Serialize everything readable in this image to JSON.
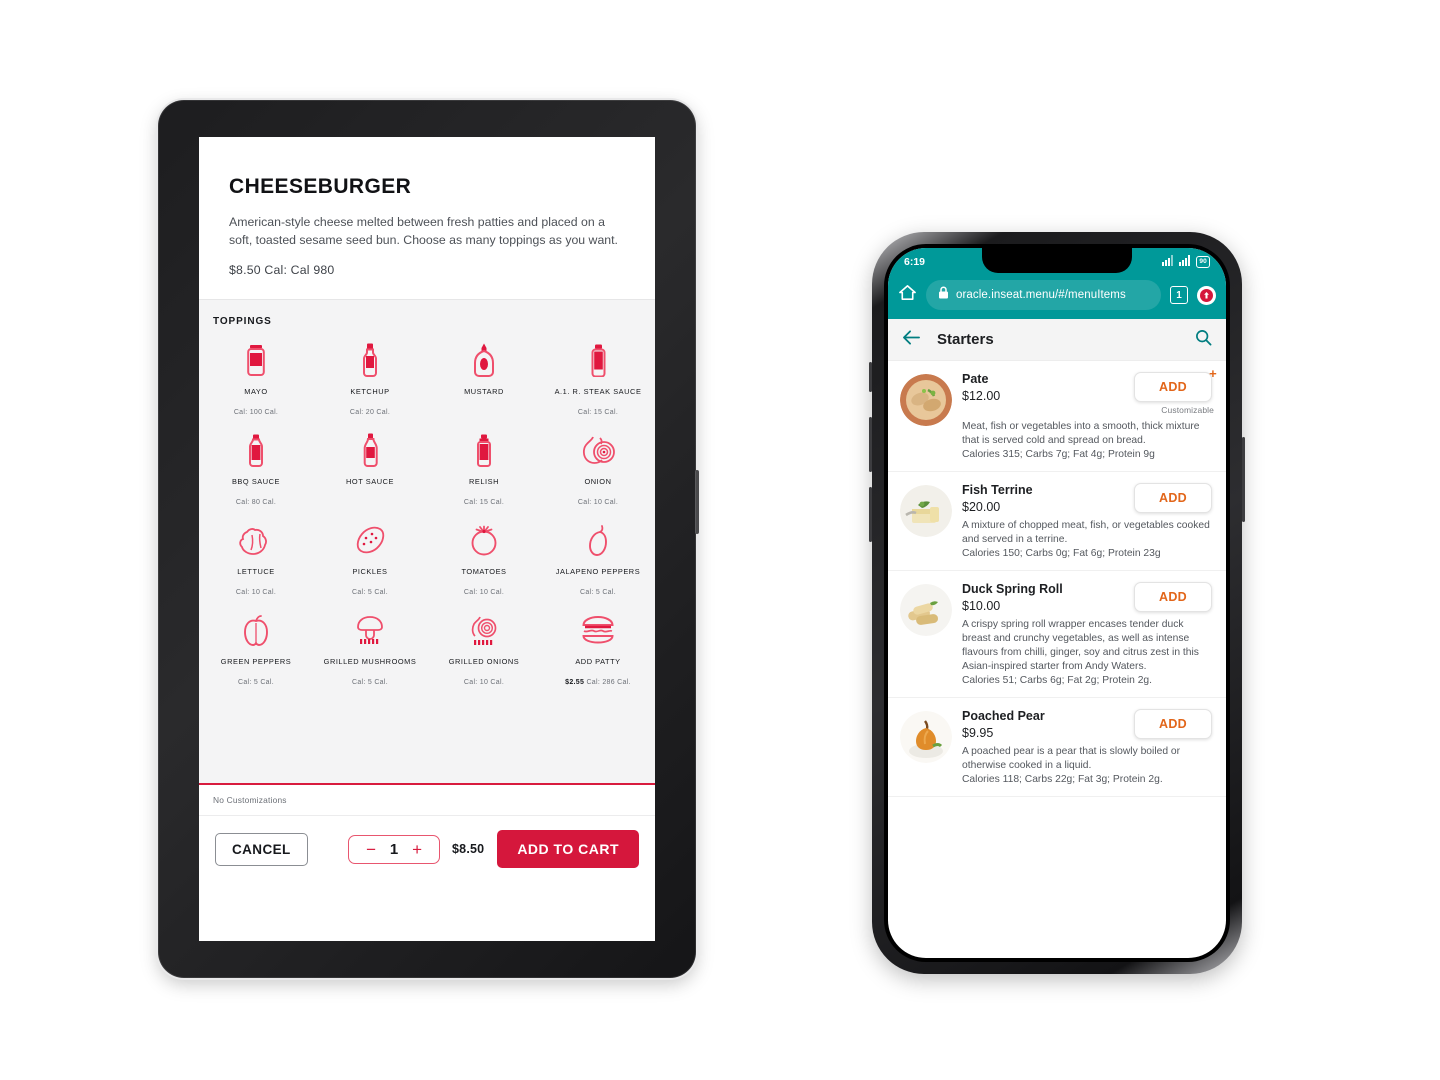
{
  "tablet": {
    "item": {
      "title": "CHEESEBURGER",
      "description": "American-style cheese melted between fresh patties and placed on a soft, toasted sesame seed bun. Choose as many toppings as you want.",
      "price_cal": "$8.50  Cal: Cal 980"
    },
    "toppings_label": "TOPPINGS",
    "toppings": [
      {
        "name": "MAYO",
        "cal": "Cal: 100 Cal.",
        "price": "",
        "icon": "mayo-jar-icon"
      },
      {
        "name": "KETCHUP",
        "cal": "Cal: 20 Cal.",
        "price": "",
        "icon": "ketchup-bottle-icon"
      },
      {
        "name": "MUSTARD",
        "cal": "",
        "price": "",
        "icon": "mustard-squeeze-bottle-icon"
      },
      {
        "name": "A.1. R. STEAK SAUCE",
        "cal": "Cal: 15 Cal.",
        "price": "",
        "icon": "steak-sauce-bottle-icon"
      },
      {
        "name": "BBQ SAUCE",
        "cal": "Cal: 80 Cal.",
        "price": "",
        "icon": "bbq-sauce-bottle-icon"
      },
      {
        "name": "HOT SAUCE",
        "cal": "",
        "price": "",
        "icon": "hot-sauce-bottle-icon"
      },
      {
        "name": "RELISH",
        "cal": "Cal: 15 Cal.",
        "price": "",
        "icon": "relish-jar-icon"
      },
      {
        "name": "ONION",
        "cal": "Cal: 10 Cal.",
        "price": "",
        "icon": "onion-icon"
      },
      {
        "name": "LETTUCE",
        "cal": "Cal: 10 Cal.",
        "price": "",
        "icon": "lettuce-icon"
      },
      {
        "name": "PICKLES",
        "cal": "Cal: 5 Cal.",
        "price": "",
        "icon": "pickle-icon"
      },
      {
        "name": "TOMATOES",
        "cal": "Cal: 10 Cal.",
        "price": "",
        "icon": "tomato-icon"
      },
      {
        "name": "JALAPENO PEPPERS",
        "cal": "Cal: 5 Cal.",
        "price": "",
        "icon": "chili-pepper-icon"
      },
      {
        "name": "GREEN PEPPERS",
        "cal": "Cal: 5 Cal.",
        "price": "",
        "icon": "bell-pepper-icon"
      },
      {
        "name": "GRILLED MUSHROOMS",
        "cal": "Cal: 5 Cal.",
        "price": "",
        "icon": "grilled-mushroom-icon"
      },
      {
        "name": "GRILLED ONIONS",
        "cal": "Cal: 10 Cal.",
        "price": "",
        "icon": "grilled-onion-icon"
      },
      {
        "name": "ADD PATTY",
        "cal": "Cal: 286 Cal.",
        "price": "$2.55",
        "icon": "burger-patty-icon"
      }
    ],
    "customizations_note": "No Customizations",
    "cancel_label": "CANCEL",
    "quantity": "1",
    "minus_label": "−",
    "plus_label": "+",
    "total_price": "$8.50",
    "add_to_cart_label": "ADD TO CART",
    "accent_color": "#d5173c"
  },
  "phone": {
    "status": {
      "time": "6:19",
      "battery": "90"
    },
    "browser": {
      "url": "oracle.inseat.menu/#/menuItems",
      "tab_count": "1",
      "chrome_color": "#009999"
    },
    "app": {
      "title": "Starters"
    },
    "menu_items": [
      {
        "name": "Pate",
        "price": "$12.00",
        "add_label": "ADD",
        "customizable_label": "Customizable",
        "has_plus": true,
        "description": "Meat, fish or vegetables into a smooth, thick mixture that is served cold and spread on bread.",
        "nutrition": "Calories 315; Carbs 7g; Fat 4g; Protein 9g"
      },
      {
        "name": "Fish Terrine",
        "price": "$20.00",
        "add_label": "ADD",
        "customizable_label": "",
        "has_plus": false,
        "description": "A mixture of chopped meat, fish, or vegetables cooked and served in a terrine.",
        "nutrition": "Calories 150; Carbs 0g; Fat 6g; Protein 23g"
      },
      {
        "name": "Duck Spring Roll",
        "price": "$10.00",
        "add_label": "ADD",
        "customizable_label": "",
        "has_plus": false,
        "description": "A crispy spring roll wrapper encases tender duck breast and crunchy vegetables, as well as intense flavours from chilli, ginger, soy and citrus zest in this Asian-inspired starter from Andy Waters.",
        "nutrition": "Calories 51; Carbs 6g; Fat 2g; Protein 2g."
      },
      {
        "name": "Poached Pear",
        "price": "$9.95",
        "add_label": "ADD",
        "customizable_label": "",
        "has_plus": false,
        "description": "A poached pear is a pear that is slowly boiled or otherwise cooked in a liquid.",
        "nutrition": "Calories 118; Carbs 22g; Fat 3g; Protein 2g."
      }
    ],
    "accent_color": "#e2661a"
  }
}
